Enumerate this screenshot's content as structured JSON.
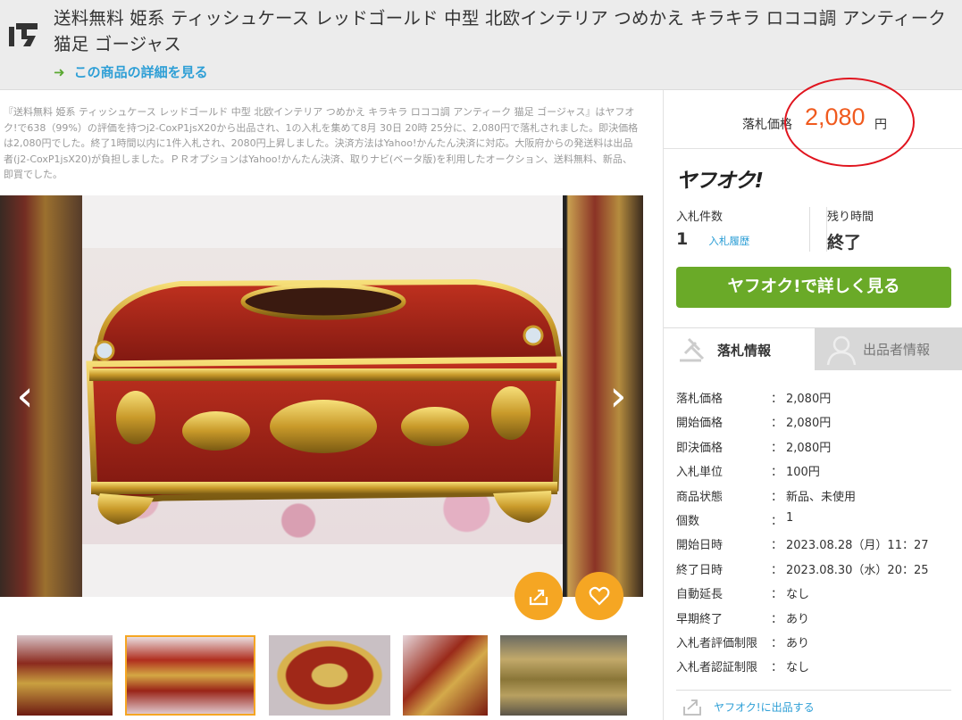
{
  "header": {
    "title": "送料無料 姫系 ティッシュケース レッドゴールド 中型 北欧インテリア つめかえ キラキラ ロココ調 アンティーク 猫足 ゴージャス",
    "detail_link": "この商品の詳細を見る",
    "detail_arrow": "➜"
  },
  "description": "『送料無料 姫系 ティッシュケース レッドゴールド 中型 北欧インテリア つめかえ キラキラ ロココ調 アンティーク 猫足 ゴージャス』はヤフオク!で638（99%）の評価を持つj2-CoxP1jsX20から出品され、1の入札を集めて8月 30日 20時 25分に、2,080円で落札されました。即決価格は2,080円でした。終了1時間以内に1件入札され、2080円上昇しました。決済方法はYahoo!かんたん決済に対応。大阪府からの発送料は出品者(j2-CoxP1jsX20)が負担しました。ＰＲオプションはYahoo!かんたん決済、取りナビ(ベータ版)を利用したオークション、送料無料、新品、即買でした。",
  "gallery": {
    "prev": "‹",
    "next": "›",
    "thumbnail_count": 5,
    "selected_thumbnail": 2
  },
  "price": {
    "label": "落札価格",
    "value": "2,080",
    "unit": "円"
  },
  "brand": "ヤフオク!",
  "stats": {
    "bids_label": "入札件数",
    "bids_value": "1",
    "history_link": "入札履歴",
    "remaining_label": "残り時間",
    "remaining_value": "終了"
  },
  "cta": "ヤフオク!で詳しく見る",
  "tabs": {
    "active": "落札情報",
    "inactive": "出品者情報"
  },
  "info_separator": "：",
  "info": [
    {
      "k": "落札価格",
      "v": "2,080円"
    },
    {
      "k": "開始価格",
      "v": "2,080円"
    },
    {
      "k": "即決価格",
      "v": "2,080円"
    },
    {
      "k": "入札単位",
      "v": "100円"
    },
    {
      "k": "商品状態",
      "v": "新品、未使用"
    },
    {
      "k": "個数",
      "v": "1"
    },
    {
      "k": "開始日時",
      "v": "2023.08.28（月）11：27"
    },
    {
      "k": "終了日時",
      "v": "2023.08.30（水）20：25"
    },
    {
      "k": "自動延長",
      "v": "なし"
    },
    {
      "k": "早期終了",
      "v": "あり"
    },
    {
      "k": "入札者評価制限",
      "v": "あり"
    },
    {
      "k": "入札者認証制限",
      "v": "なし"
    }
  ],
  "sell_link": "ヤフオク!に出品する",
  "colors": {
    "accent": "#f05a1e",
    "cta": "#6aaa28",
    "link": "#2e9fd6",
    "fab": "#f5a623",
    "annotation": "#e0141e"
  }
}
